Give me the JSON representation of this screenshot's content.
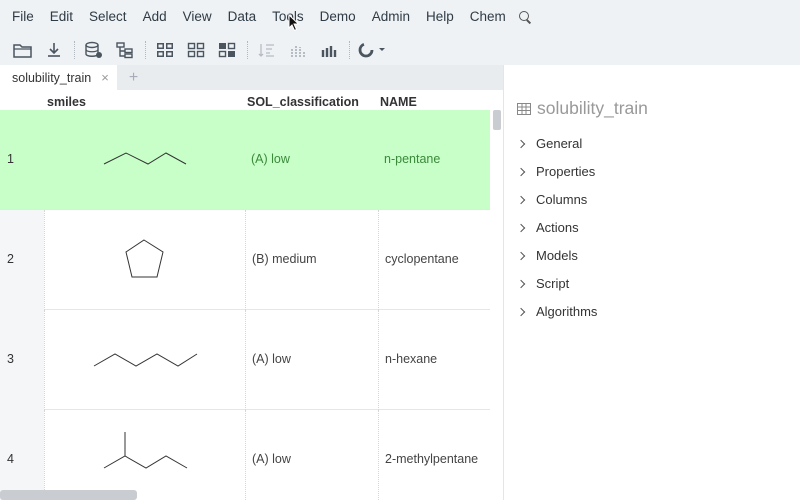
{
  "menu": [
    "File",
    "Edit",
    "Select",
    "Add",
    "View",
    "Data",
    "Tools",
    "Demo",
    "Admin",
    "Help",
    "Chem"
  ],
  "toolbar": {
    "icons": [
      "open-folder-icon",
      "download-icon",
      "database-add-icon",
      "tree-icon",
      "grid-view-icon",
      "grid-small-icon",
      "grid-detail-icon",
      "sort-disabled-icon",
      "bar-chart-disabled-icon",
      "bar-chart-icon",
      "spinner-dropdown-icon"
    ]
  },
  "tab": {
    "label": "solubility_train",
    "close": "×",
    "add": "+"
  },
  "grid": {
    "columns": [
      "smiles",
      "SOL_classification",
      "NAME"
    ],
    "rows": [
      {
        "num": "1",
        "molecule": "pentane-chain",
        "sol": "(A) low",
        "name": "n-pentane",
        "selected": true
      },
      {
        "num": "2",
        "molecule": "cyclopentane-ring",
        "sol": "(B) medium",
        "name": "cyclopentane",
        "selected": false
      },
      {
        "num": "3",
        "molecule": "hexane-chain",
        "sol": "(A) low",
        "name": "n-hexane",
        "selected": false
      },
      {
        "num": "4",
        "molecule": "methylpentane-branched",
        "sol": "(A) low",
        "name": "2-methylpentane",
        "selected": false
      }
    ]
  },
  "panel": {
    "title": "solubility_train",
    "sections": [
      "General",
      "Properties",
      "Columns",
      "Actions",
      "Models",
      "Script",
      "Algorithms"
    ]
  },
  "colors": {
    "selected_row": "#c8ffc8",
    "menubar": "#eef2f5",
    "accent": "#3a8a3a"
  }
}
